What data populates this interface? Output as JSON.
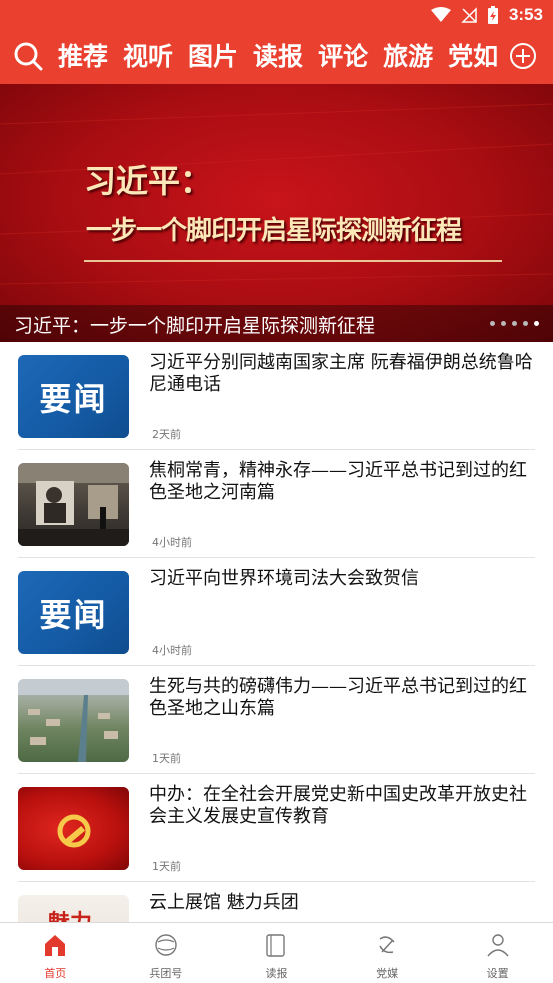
{
  "status_bar": {
    "time": "3:53"
  },
  "top_nav": {
    "tabs": [
      "推荐",
      "视听",
      "图片",
      "读报",
      "评论",
      "旅游",
      "党如"
    ]
  },
  "banner": {
    "art_line1": "习近平：",
    "art_line2": "一步一个脚印开启星际探测新征程",
    "caption": "习近平：一步一个脚印开启星际探测新征程",
    "dots_total": 5,
    "active_dot": 5
  },
  "news": [
    {
      "title": "习近平分别同越南国家主席 阮春福伊朗总统鲁哈尼通电话",
      "time": "2天前",
      "thumb": "yaowen",
      "thumb_text": "要闻"
    },
    {
      "title": "焦桐常青，精神永存——习近平总书记到过的红色圣地之河南篇",
      "time": "4小时前",
      "thumb": "museum"
    },
    {
      "title": "习近平向世界环境司法大会致贺信",
      "time": "4小时前",
      "thumb": "yaowen",
      "thumb_text": "要闻"
    },
    {
      "title": "生死与共的磅礴伟力——习近平总书记到过的红色圣地之山东篇",
      "time": "1天前",
      "thumb": "aerial"
    },
    {
      "title": "中办：在全社会开展党史新中国史改革开放史社会主义发展史宣传教育",
      "time": "1天前",
      "thumb": "flag"
    },
    {
      "title": "云上展馆 魅力兵团",
      "time": "",
      "thumb": "exhibit",
      "thumb_text": "魅力"
    }
  ],
  "bottom_nav": {
    "items": [
      {
        "label": "首页",
        "icon": "home-icon",
        "active": true
      },
      {
        "label": "兵团号",
        "icon": "globe-icon",
        "active": false
      },
      {
        "label": "读报",
        "icon": "newspaper-icon",
        "active": false
      },
      {
        "label": "党媒",
        "icon": "party-emblem-icon",
        "active": false
      },
      {
        "label": "设置",
        "icon": "user-icon",
        "active": false
      }
    ]
  },
  "colors": {
    "brand_red": "#e9402f",
    "active_tab": "#e33a2e",
    "yaowen_blue": "#1660ad"
  }
}
